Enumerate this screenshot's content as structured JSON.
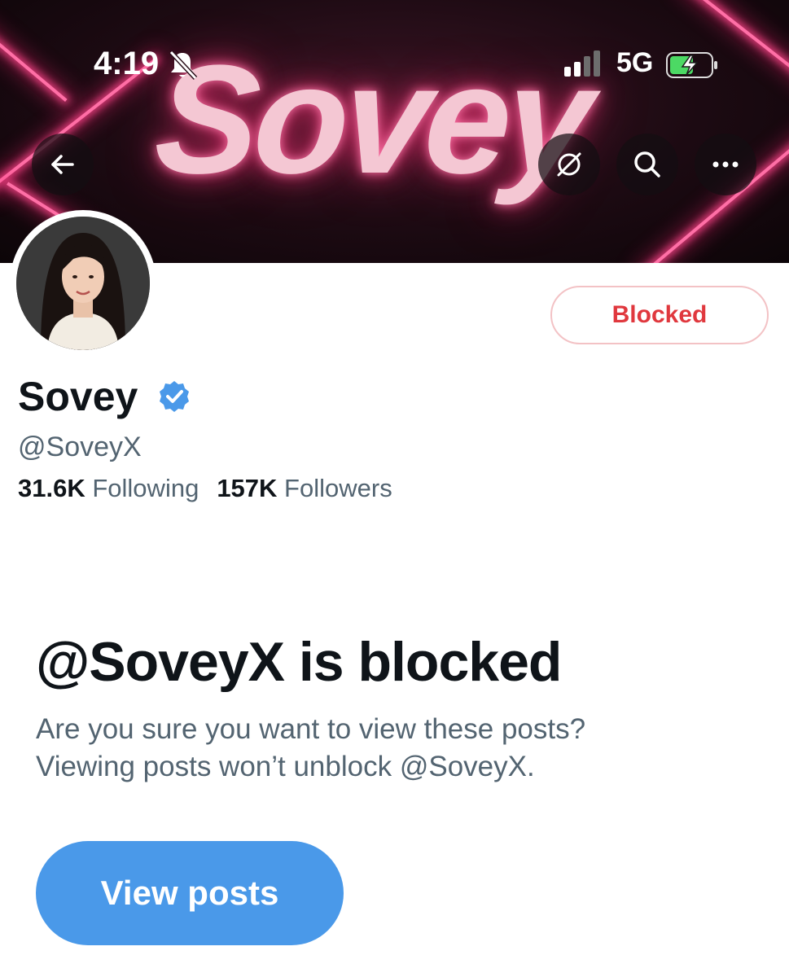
{
  "status_bar": {
    "time": "4:19",
    "network": "5G",
    "icons": [
      "bell-slash-icon",
      "signal-icon",
      "battery-charging-icon"
    ]
  },
  "banner": {
    "text": "Sovey",
    "accent_color": "#ff4f96"
  },
  "header": {
    "icons": [
      "back-arrow-icon",
      "translate-icon",
      "search-icon",
      "more-icon"
    ]
  },
  "profile": {
    "display_name": "Sovey",
    "handle": "@SoveyX",
    "verified": true,
    "following_count": "31.6K",
    "following_label": "Following",
    "followers_count": "157K",
    "followers_label": "Followers",
    "blocked_button_label": "Blocked"
  },
  "blocked_notice": {
    "title": "@SoveyX is blocked",
    "line1": "Are you sure you want to view these posts?",
    "line2": "Viewing posts won’t unblock @SoveyX.",
    "view_button_label": "View posts"
  },
  "colors": {
    "blocked_red": "#e0383e",
    "primary_blue": "#4a99e9",
    "secondary_text": "#536471"
  }
}
